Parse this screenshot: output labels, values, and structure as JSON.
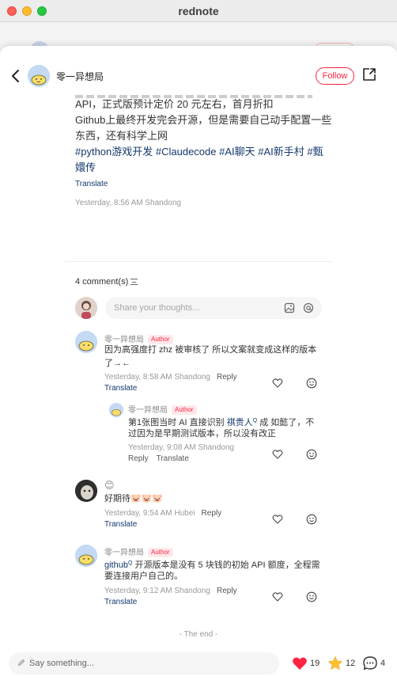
{
  "window": {
    "title": "rednote"
  },
  "header": {
    "author": "零一异想局",
    "follow_label": "Follow"
  },
  "post": {
    "lines": [
      "API，正式版预计定价 20 元左右，首月折扣",
      "Github上最终开发完会开源，但是需要自己动手配置一些",
      "东西，还有科学上网"
    ],
    "tags_line1": "#python游戏开发 #Claudecode #AI聊天 #AI新手村 #甄",
    "tags_line2": "嬛传",
    "translate": "Translate",
    "meta": "Yesterday, 8:56 AM Shandong"
  },
  "comments_section": {
    "count_label": "4 comment(s)",
    "input_placeholder": "Share your thoughts...",
    "end_label": "- The end -"
  },
  "comments": [
    {
      "author": "零一异想局",
      "badge": "Author",
      "line1": "因为高强度打 zhz 被审核了 所以文案就变成这样的版本",
      "line2": "了→←",
      "meta": "Yesterday, 8:58 AM Shandong",
      "reply": "Reply",
      "translate": "Translate"
    },
    {
      "author": "零一异想局",
      "badge": "Author",
      "line1_a": "第1张图当时 AI 直接识别 ",
      "line1_link": "祺贵人",
      "line1_b": " 成 如懿了，不",
      "line2": "过因为是早期测试版本，所以没有改正",
      "meta": "Yesterday, 9:08 AM Shandong",
      "reply": "Reply",
      "translate": "Translate"
    },
    {
      "author": "😊",
      "line1": "好期待🐷🐷🐷",
      "meta": "Yesterday, 9:54 AM Hubei",
      "reply": "Reply",
      "translate": "Translate"
    },
    {
      "author": "零一异想局",
      "badge": "Author",
      "line1_link": "github",
      "line1_b": " 开源版本是没有 5 块钱的初始 API 额度，全程需",
      "line2": "要连接用户自己的。",
      "meta": "Yesterday, 9:12 AM Shandong",
      "reply": "Reply",
      "translate": "Translate"
    }
  ],
  "bottom": {
    "placeholder": "Say something...",
    "likes": "19",
    "collects": "12",
    "comments": "4"
  },
  "colors": {
    "accent": "#ff2442",
    "link": "#13386c"
  }
}
